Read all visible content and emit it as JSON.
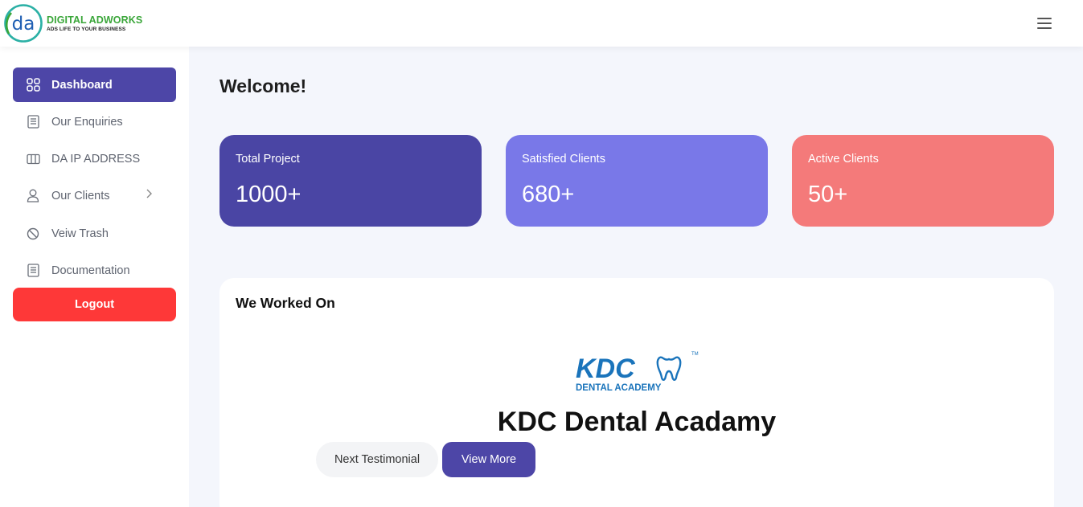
{
  "brand": {
    "name_part1": "DIGITAL ",
    "name_part2": "ADWORKS",
    "tagline": "ADS LIFE TO YOUR BUSINESS",
    "logo_letters": "da"
  },
  "header": {
    "menu_icon": "hamburger-icon"
  },
  "sidebar": {
    "items": [
      {
        "label": "Dashboard",
        "icon": "grid-icon",
        "active": true
      },
      {
        "label": "Our Enquiries",
        "icon": "document-icon"
      },
      {
        "label": "DA IP ADDRESS",
        "icon": "columns-icon"
      },
      {
        "label": "Our Clients",
        "icon": "user-icon",
        "has_submenu": true
      },
      {
        "label": "Veiw Trash",
        "icon": "ban-icon"
      },
      {
        "label": "Documentation",
        "icon": "document-icon"
      }
    ],
    "logout_label": "Logout"
  },
  "main": {
    "welcome": "Welcome!",
    "stats": [
      {
        "label": "Total Project",
        "value": "1000+",
        "color": "#4a45a4"
      },
      {
        "label": "Satisfied Clients",
        "value": "680+",
        "color": "#7978e8"
      },
      {
        "label": "Active Clients",
        "value": "50+",
        "color": "#f47a7a"
      }
    ],
    "worked_on": {
      "title": "We Worked On",
      "logo_text": "KDC",
      "logo_subtext": "DENTAL ACADEMY",
      "logo_tm": "TM",
      "project_name": "KDC Dental Acadamy",
      "next_label": "Next Testimonial",
      "more_label": "View More"
    }
  },
  "colors": {
    "primary": "#4d46a7",
    "danger": "#fe3838",
    "brand_green": "#3aa639",
    "brand_blue": "#1f5fb3",
    "kdc_blue": "#1a74bb"
  }
}
